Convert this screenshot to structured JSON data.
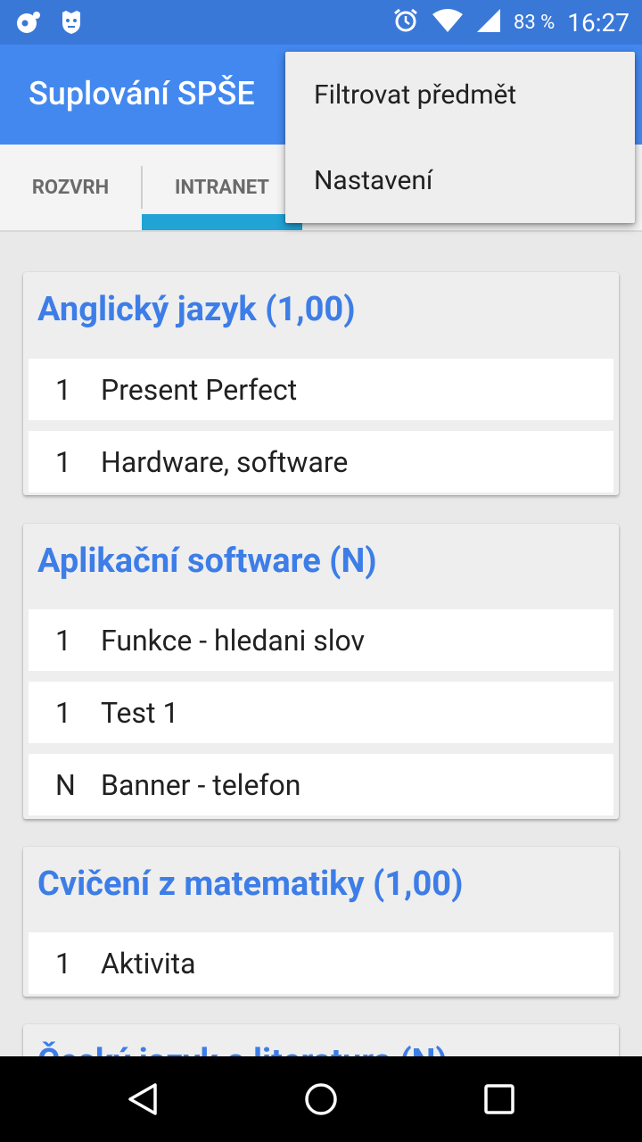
{
  "status_bar": {
    "battery_percent": "83 %",
    "time": "16:27",
    "icons": [
      "notification-icon",
      "android-icon",
      "alarm-icon",
      "wifi-icon",
      "signal-icon",
      "battery-icon"
    ]
  },
  "app_bar": {
    "title": "Suplování SPŠE"
  },
  "tabs": [
    {
      "label": "ROZVRH",
      "selected": false
    },
    {
      "label": "INTRANET",
      "selected": true
    }
  ],
  "menu": {
    "items": [
      {
        "label": "Filtrovat předmět"
      },
      {
        "label": "Nastavení"
      }
    ]
  },
  "subjects": [
    {
      "title": "Anglický jazyk (1,00)",
      "grades": [
        {
          "grade": "1",
          "label": "Present Perfect"
        },
        {
          "grade": "1",
          "label": "Hardware, software"
        }
      ]
    },
    {
      "title": "Aplikační software (N)",
      "grades": [
        {
          "grade": "1",
          "label": "Funkce - hledani slov"
        },
        {
          "grade": "1",
          "label": "Test 1"
        },
        {
          "grade": "N",
          "label": "Banner - telefon"
        }
      ]
    },
    {
      "title": "Cvičení z matematiky (1,00)",
      "grades": [
        {
          "grade": "1",
          "label": "Aktivita"
        }
      ]
    },
    {
      "title": "Český jazyk a literatura (N)",
      "grades": []
    }
  ],
  "colors": {
    "status_bar": "#3a78d8",
    "app_bar": "#4388ef",
    "tab_indicator": "#21a3d6",
    "subject_title": "#3d7de8"
  },
  "nav_bar": {
    "icons": [
      "back-icon",
      "home-icon",
      "recents-icon"
    ]
  }
}
